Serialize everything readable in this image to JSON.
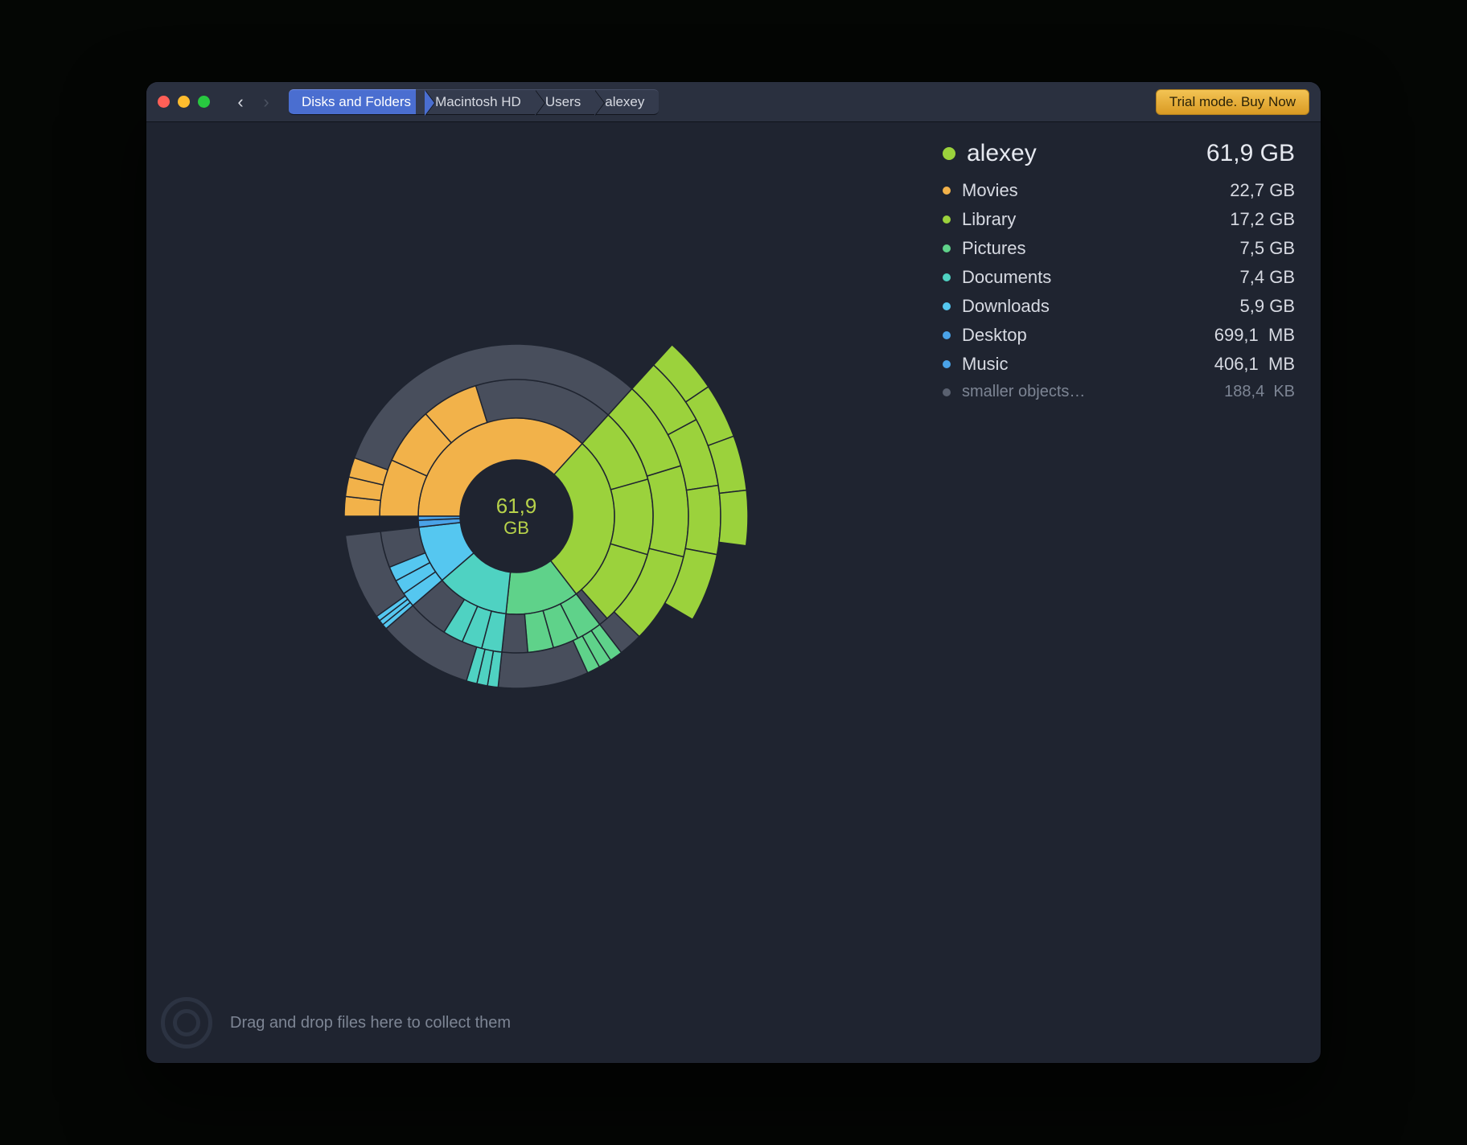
{
  "window": {
    "close": "Close",
    "minimize": "Minimize",
    "zoom": "Zoom"
  },
  "toolbar": {
    "back": "‹",
    "forward": "›",
    "breadcrumb": [
      "Disks and Folders",
      "Macintosh HD",
      "Users",
      "alexey"
    ],
    "buy_label": "Trial mode. Buy Now"
  },
  "summary": {
    "name": "alexey",
    "size": "61,9 GB",
    "dot_color": "#9bd23c"
  },
  "items": [
    {
      "name": "Movies",
      "size": "22,7 GB",
      "color": "#f2b24a",
      "bytes": 22700000000
    },
    {
      "name": "Library",
      "size": "17,2 GB",
      "color": "#9bd23c",
      "bytes": 17200000000
    },
    {
      "name": "Pictures",
      "size": "7,5 GB",
      "color": "#5fd28a",
      "bytes": 7500000000
    },
    {
      "name": "Documents",
      "size": "7,4 GB",
      "color": "#4fd2c2",
      "bytes": 7400000000
    },
    {
      "name": "Downloads",
      "size": "5,9 GB",
      "color": "#55c7f0",
      "bytes": 5900000000
    },
    {
      "name": "Desktop",
      "size": "699,1  MB",
      "color": "#4aa3e8",
      "bytes": 699100000
    },
    {
      "name": "Music",
      "size": "406,1  MB",
      "color": "#4aa3e8",
      "bytes": 406100000
    },
    {
      "name": "smaller objects…",
      "size": "188,4  KB",
      "color": "#5a6170",
      "bytes": 188400,
      "dim": true
    }
  ],
  "footer": {
    "hint": "Drag and drop files here to collect them"
  },
  "chart_data": {
    "type": "sunburst",
    "title": "alexey disk usage",
    "center_label": "61,9",
    "center_unit": "GB",
    "total_bytes": 61900000000,
    "series": [
      {
        "name": "Movies",
        "value": 22700000000,
        "color": "#f2b24a"
      },
      {
        "name": "Library",
        "value": 17200000000,
        "color": "#9bd23c"
      },
      {
        "name": "Pictures",
        "value": 7500000000,
        "color": "#5fd28a"
      },
      {
        "name": "Documents",
        "value": 7400000000,
        "color": "#4fd2c2"
      },
      {
        "name": "Downloads",
        "value": 5900000000,
        "color": "#55c7f0"
      },
      {
        "name": "Desktop",
        "value": 699100000,
        "color": "#4aa3e8"
      },
      {
        "name": "Music",
        "value": 406100000,
        "color": "#4aa3e8"
      }
    ],
    "depth_levels_shown": 5,
    "start_angle_deg": 180
  }
}
